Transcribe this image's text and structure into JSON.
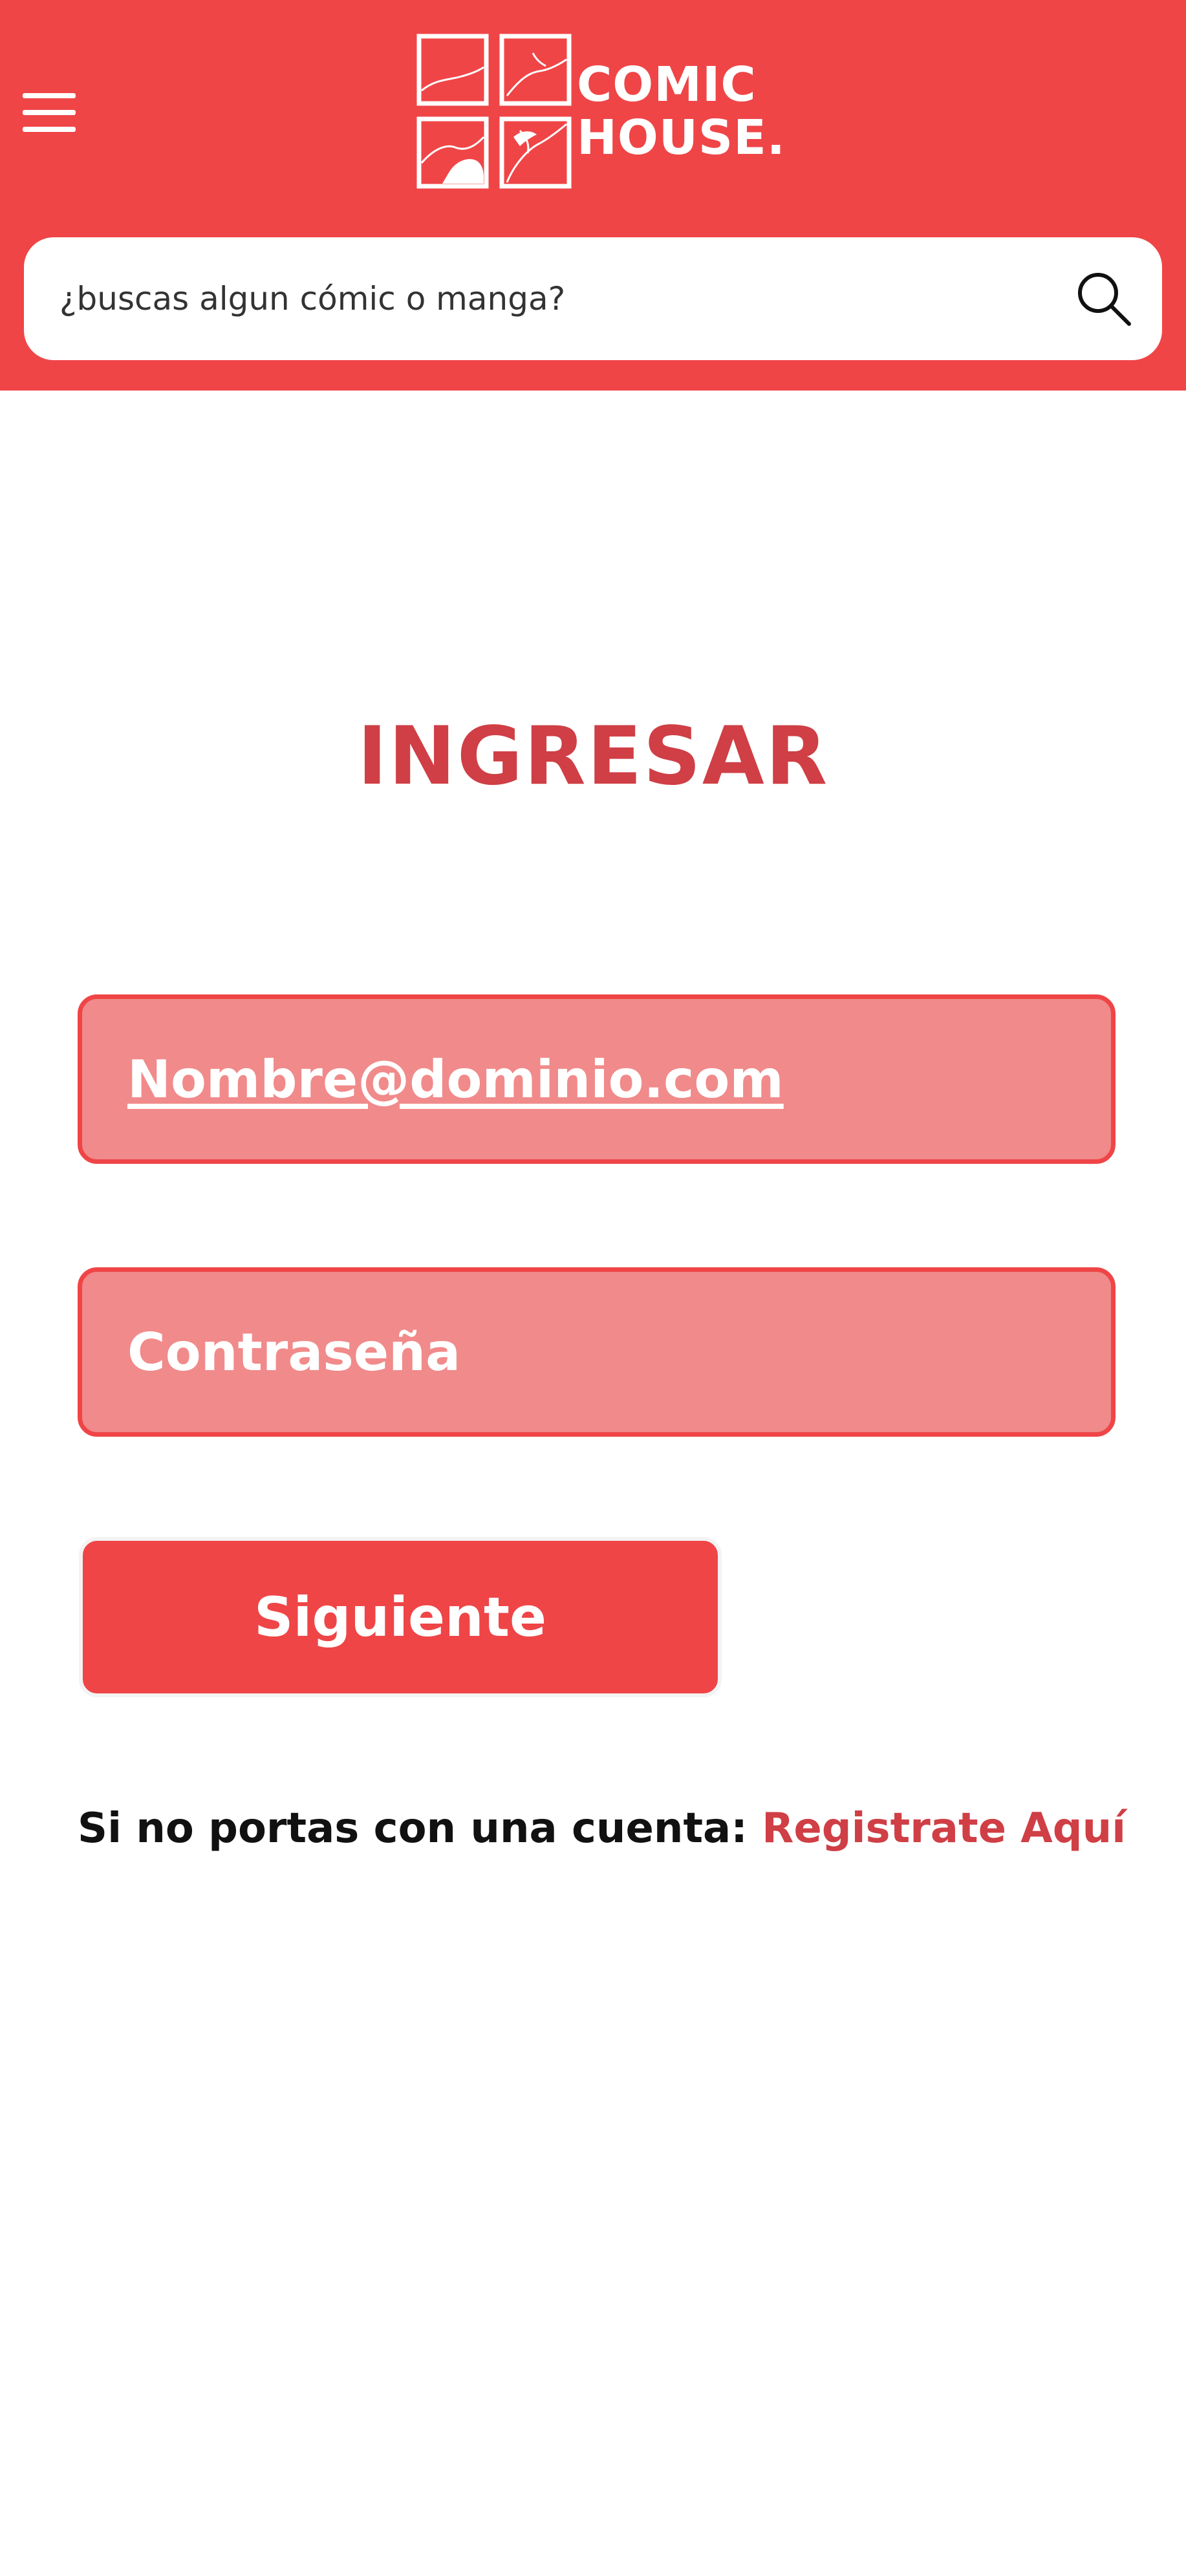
{
  "header": {
    "brand": {
      "line1": "COMIC",
      "line2": "HOUSE."
    },
    "menu_icon": "hamburger-menu-icon",
    "search": {
      "placeholder": "¿buscas algun cómic o manga?",
      "icon": "search-icon"
    }
  },
  "login": {
    "title": "INGRESAR",
    "email_placeholder": "Nombre@dominio.com",
    "password_placeholder": "Contraseña",
    "next_label": "Siguiente",
    "register_prompt": "Si no portas con una cuenta:",
    "register_link": "Registrate Aquí"
  },
  "colors": {
    "primary": "#ef4547",
    "title": "#cf3f45",
    "field_fill": "#f18a8a",
    "text_dark": "#111111",
    "white": "#ffffff"
  }
}
